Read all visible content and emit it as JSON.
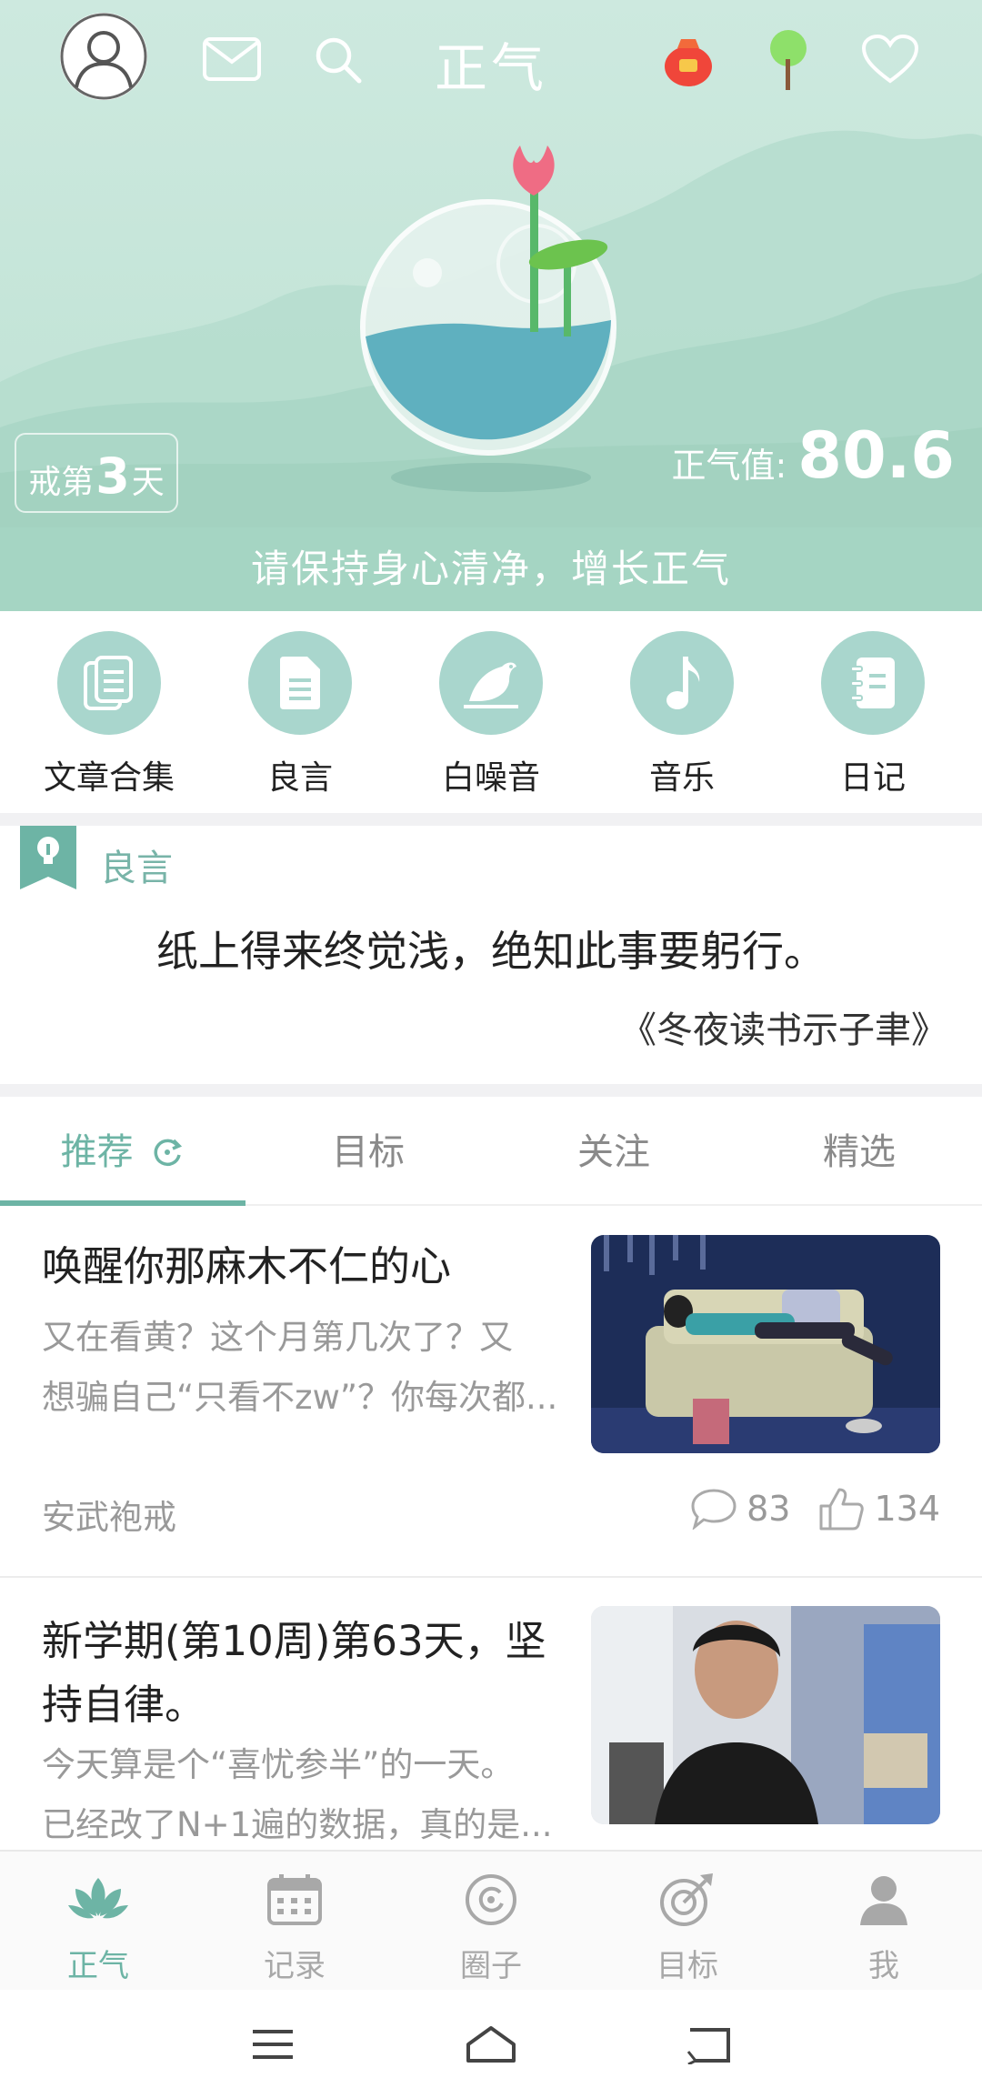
{
  "header": {
    "app_title": "正气",
    "day_badge": {
      "prefix": "戒第",
      "number": "3",
      "suffix": "天"
    },
    "score": {
      "label": "正气值:",
      "value": "80.6"
    },
    "slogan": "请保持身心清净，增长正气"
  },
  "quick_menu": [
    {
      "label": "文章合集",
      "icon": "documents-icon"
    },
    {
      "label": "良言",
      "icon": "document-icon"
    },
    {
      "label": "白噪音",
      "icon": "bird-icon"
    },
    {
      "label": "音乐",
      "icon": "music-note-icon"
    },
    {
      "label": "日记",
      "icon": "notebook-icon"
    }
  ],
  "quote": {
    "title": "良言",
    "text": "纸上得来终觉浅，绝知此事要躬行。",
    "source": "《冬夜读书示子聿》"
  },
  "tabs": [
    {
      "label": "推荐",
      "active": true
    },
    {
      "label": "目标",
      "active": false
    },
    {
      "label": "关注",
      "active": false
    },
    {
      "label": "精选",
      "active": false
    }
  ],
  "posts": [
    {
      "title": "唤醒你那麻木不仁的心",
      "desc_line1": "又在看黄？这个月第几次了？又",
      "desc_line2": "想骗自己“只看不zw”？你每次都...",
      "author": "安武袍戒",
      "comments": "83",
      "likes": "134"
    },
    {
      "title_line1": "新学期(第10周)第63天，坚",
      "title_line2": "持自律。",
      "desc_line1": "今天算是个“喜忧参半”的一天。",
      "desc_line2": "已经改了N+1遍的数据，真的是..."
    }
  ],
  "bottom_nav": [
    {
      "label": "正气",
      "icon": "lotus-icon",
      "active": true
    },
    {
      "label": "记录",
      "icon": "calendar-icon",
      "active": false
    },
    {
      "label": "圈子",
      "icon": "circle-icon",
      "active": false
    },
    {
      "label": "目标",
      "icon": "target-icon",
      "active": false
    },
    {
      "label": "我",
      "icon": "person-icon",
      "active": false
    }
  ],
  "colors": {
    "accent": "#6db4a5",
    "hero_bg": "#c7e6da",
    "slogan_bg": "#a5d5c3"
  }
}
